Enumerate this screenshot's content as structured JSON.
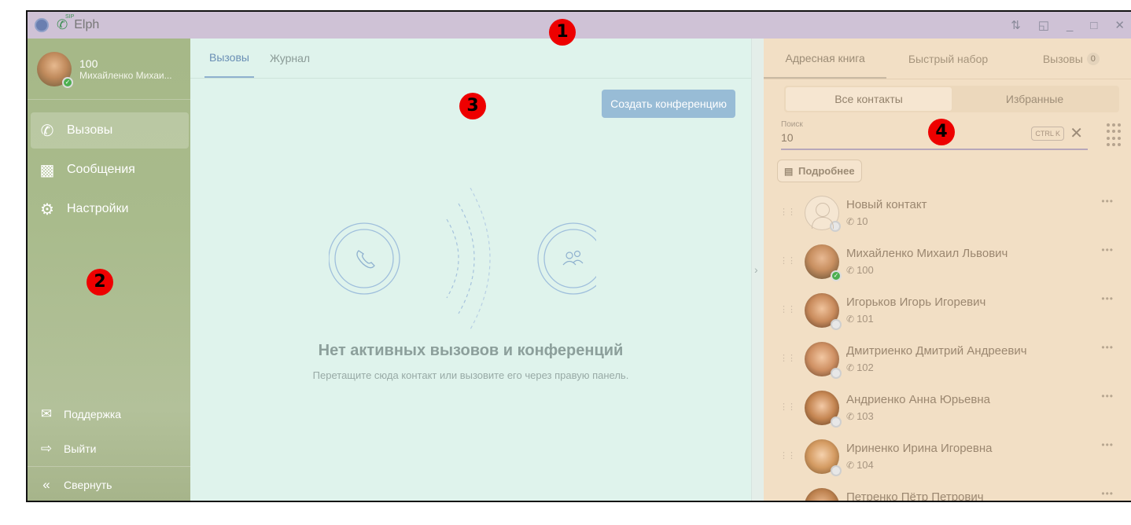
{
  "window": {
    "title": "Elph",
    "sip_badge": "SIP",
    "controls": [
      "pin-icon",
      "restore-icon",
      "minimize-icon",
      "maximize-icon",
      "close-icon"
    ]
  },
  "markers": [
    "1",
    "2",
    "3",
    "4"
  ],
  "profile": {
    "number": "100",
    "name": "Михайленко Михаи..."
  },
  "sidebar": {
    "items": [
      {
        "label": "Вызовы",
        "icon": "phone-icon",
        "active": true
      },
      {
        "label": "Сообщения",
        "icon": "message-icon",
        "active": false
      },
      {
        "label": "Настройки",
        "icon": "gear-icon",
        "active": false
      }
    ],
    "support": "Поддержка",
    "logout": "Выйти",
    "collapse": "Свернуть"
  },
  "center": {
    "tabs": [
      "Вызовы",
      "Журнал"
    ],
    "create_conference": "Создать конференцию",
    "empty_title": "Нет активных вызовов и конференций",
    "empty_subtitle": "Перетащите сюда контакт или вызовите его через правую панель."
  },
  "right": {
    "tabs": [
      "Адресная книга",
      "Быстрый набор",
      "Вызовы"
    ],
    "calls_count": "0",
    "segments": [
      "Все контакты",
      "Избранные"
    ],
    "search_label": "Поиск",
    "search_value": "10",
    "shortcut": "CTRL K",
    "details_button": "Подробнее",
    "contacts": [
      {
        "name": "Новый контакт",
        "number": "10",
        "status": "none"
      },
      {
        "name": "Михайленко Михаил Львович",
        "number": "100",
        "status": "online"
      },
      {
        "name": "Игорьков Игорь Игоревич",
        "number": "101",
        "status": "offline"
      },
      {
        "name": "Дмитриенко Дмитрий Андреевич",
        "number": "102",
        "status": "offline"
      },
      {
        "name": "Андриенко Анна Юрьевна",
        "number": "103",
        "status": "offline"
      },
      {
        "name": "Ириненко Ирина Игоревна",
        "number": "104",
        "status": "offline"
      },
      {
        "name": "Петренко Пётр Петрович",
        "number": "",
        "status": "offline"
      }
    ]
  },
  "colors": {
    "titlebar": "#cfc2d6",
    "sidebar": "#a9bb8c",
    "center": "#dff3ec",
    "right": "#f2dfc5",
    "accent": "#98bcd6",
    "marker": "#ee0000"
  }
}
